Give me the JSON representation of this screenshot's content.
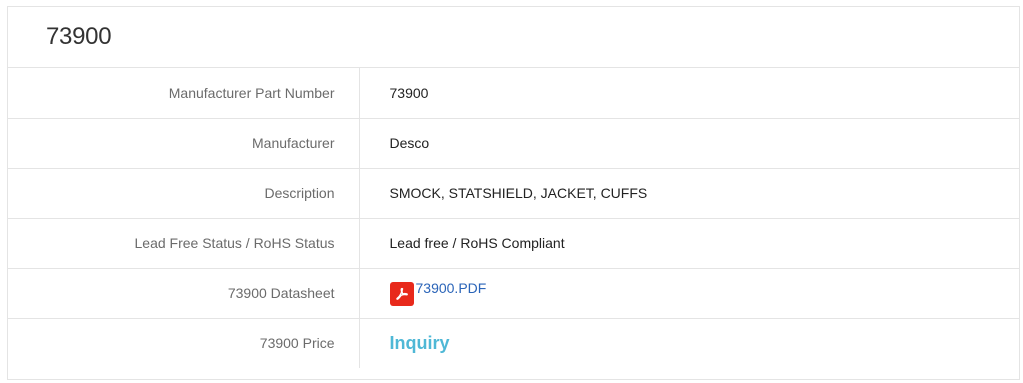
{
  "title": "73900",
  "rows": [
    {
      "label": "Manufacturer Part Number",
      "value": "73900"
    },
    {
      "label": "Manufacturer",
      "value": "Desco"
    },
    {
      "label": "Description",
      "value": "SMOCK, STATSHIELD, JACKET, CUFFS"
    },
    {
      "label": "Lead Free Status / RoHS Status",
      "value": "Lead free / RoHS Compliant"
    },
    {
      "label": "73900 Datasheet",
      "value": "73900.PDF",
      "icon": "pdf-icon"
    },
    {
      "label": "73900 Price",
      "value": "Inquiry"
    }
  ],
  "colors": {
    "link": "#2a64b8",
    "inquiry": "#4fb8d6",
    "pdf_icon": "#e8291b",
    "border": "#e4e4e4"
  }
}
